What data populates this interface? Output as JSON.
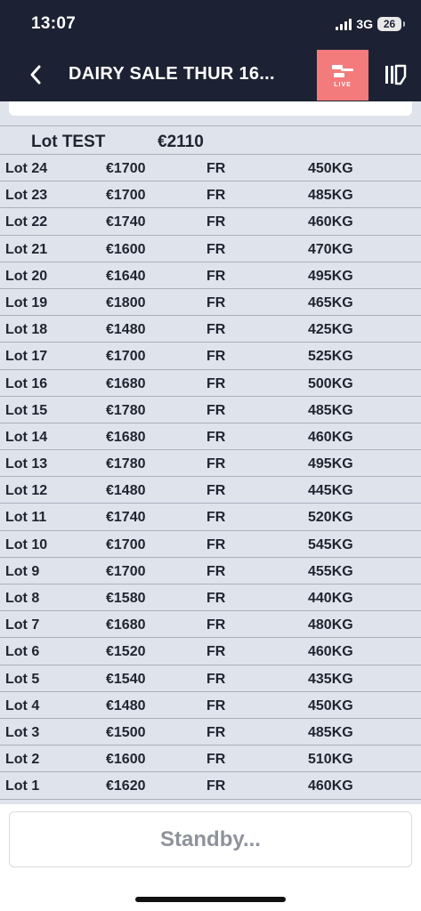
{
  "status_bar": {
    "time": "13:07",
    "network": "3G",
    "battery": "26"
  },
  "nav": {
    "title": "DAIRY SALE THUR 16...",
    "live_label": "LIVE",
    "icons": {
      "back": "chevron-left-icon",
      "live": "gavel-icon",
      "menu": "notebook-icon"
    }
  },
  "current_lot": {
    "lot": "Lot TEST",
    "price": "€2110"
  },
  "lots": [
    {
      "lot": "Lot 24",
      "price": "€1700",
      "type": "FR",
      "weight": "450KG"
    },
    {
      "lot": "Lot 23",
      "price": "€1700",
      "type": "FR",
      "weight": "485KG"
    },
    {
      "lot": "Lot 22",
      "price": "€1740",
      "type": "FR",
      "weight": "460KG"
    },
    {
      "lot": "Lot 21",
      "price": "€1600",
      "type": "FR",
      "weight": "470KG"
    },
    {
      "lot": "Lot 20",
      "price": "€1640",
      "type": "FR",
      "weight": "495KG"
    },
    {
      "lot": "Lot 19",
      "price": "€1800",
      "type": "FR",
      "weight": "465KG"
    },
    {
      "lot": "Lot 18",
      "price": "€1480",
      "type": "FR",
      "weight": "425KG"
    },
    {
      "lot": "Lot 17",
      "price": "€1700",
      "type": "FR",
      "weight": "525KG"
    },
    {
      "lot": "Lot 16",
      "price": "€1680",
      "type": "FR",
      "weight": "500KG"
    },
    {
      "lot": "Lot 15",
      "price": "€1780",
      "type": "FR",
      "weight": "485KG"
    },
    {
      "lot": "Lot 14",
      "price": "€1680",
      "type": "FR",
      "weight": "460KG"
    },
    {
      "lot": "Lot 13",
      "price": "€1780",
      "type": "FR",
      "weight": "495KG"
    },
    {
      "lot": "Lot 12",
      "price": "€1480",
      "type": "FR",
      "weight": "445KG"
    },
    {
      "lot": "Lot 11",
      "price": "€1740",
      "type": "FR",
      "weight": "520KG"
    },
    {
      "lot": "Lot 10",
      "price": "€1700",
      "type": "FR",
      "weight": "545KG"
    },
    {
      "lot": "Lot 9",
      "price": "€1700",
      "type": "FR",
      "weight": "455KG"
    },
    {
      "lot": "Lot 8",
      "price": "€1580",
      "type": "FR",
      "weight": "440KG"
    },
    {
      "lot": "Lot 7",
      "price": "€1680",
      "type": "FR",
      "weight": "480KG"
    },
    {
      "lot": "Lot 6",
      "price": "€1520",
      "type": "FR",
      "weight": "460KG"
    },
    {
      "lot": "Lot 5",
      "price": "€1540",
      "type": "FR",
      "weight": "435KG"
    },
    {
      "lot": "Lot 4",
      "price": "€1480",
      "type": "FR",
      "weight": "450KG"
    },
    {
      "lot": "Lot 3",
      "price": "€1500",
      "type": "FR",
      "weight": "485KG"
    },
    {
      "lot": "Lot 2",
      "price": "€1600",
      "type": "FR",
      "weight": "510KG"
    },
    {
      "lot": "Lot 1",
      "price": "€1620",
      "type": "FR",
      "weight": "460KG"
    }
  ],
  "footer": {
    "standby_label": "Standby..."
  },
  "colors": {
    "nav_bg": "#1c2233",
    "live_accent": "#f47b7b",
    "list_bg": "#dfe3eb",
    "standby_text": "#8e939b"
  }
}
